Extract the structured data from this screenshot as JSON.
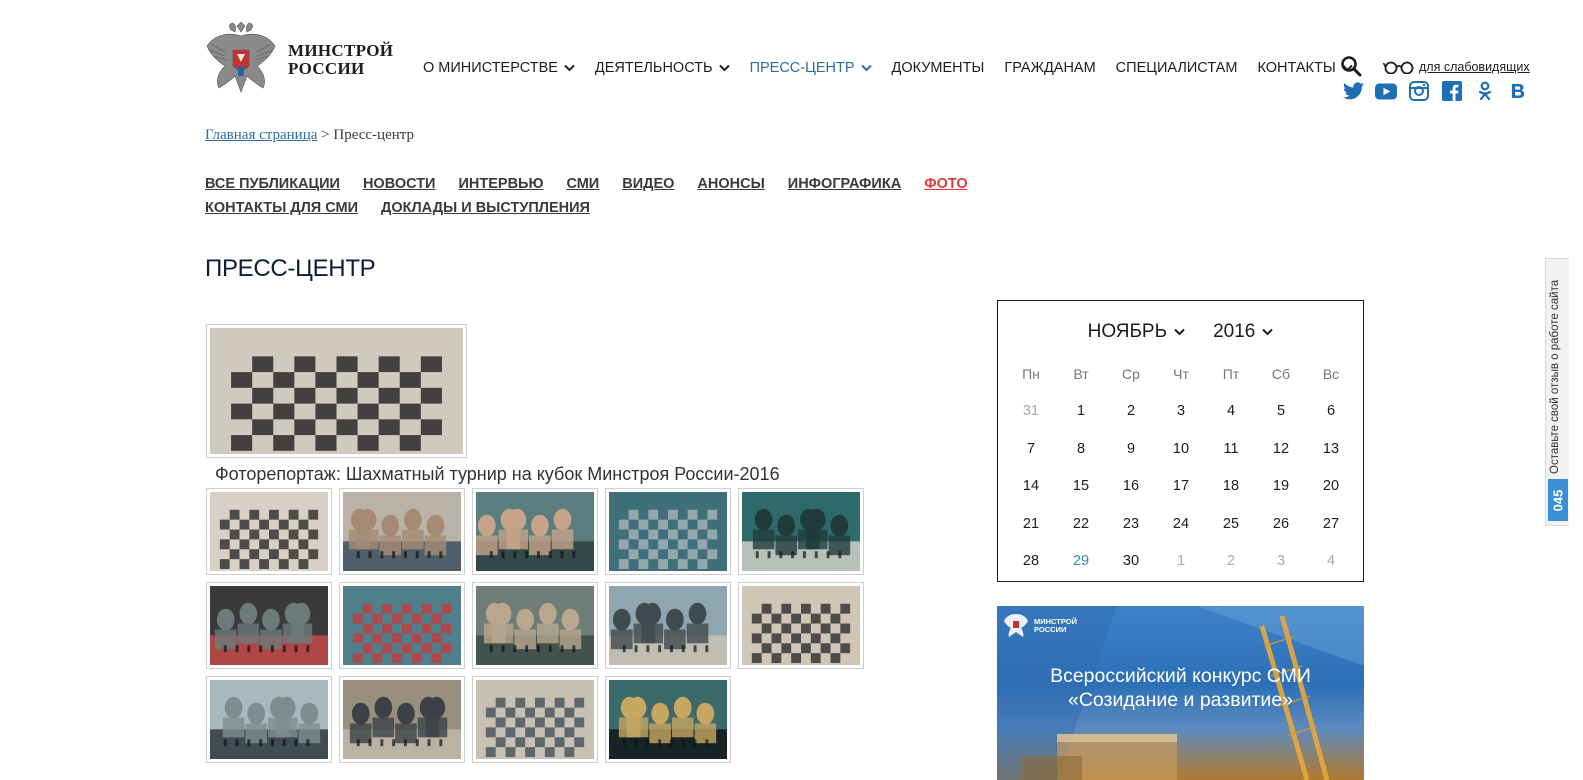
{
  "logo": {
    "line1": "МИНСТРОЙ",
    "line2": "РОССИИ"
  },
  "nav": {
    "items": [
      {
        "label": "О МИНИСТЕРСТВЕ",
        "dropdown": true,
        "active": false
      },
      {
        "label": "ДЕЯТЕЛЬНОСТЬ",
        "dropdown": true,
        "active": false
      },
      {
        "label": "ПРЕСС-ЦЕНТР",
        "dropdown": true,
        "active": true
      },
      {
        "label": "ДОКУМЕНТЫ",
        "dropdown": false,
        "active": false
      },
      {
        "label": "ГРАЖДАНАМ",
        "dropdown": false,
        "active": false
      },
      {
        "label": "СПЕЦИАЛИСТАМ",
        "dropdown": false,
        "active": false
      },
      {
        "label": "КОНТАКТЫ",
        "dropdown": true,
        "active": false
      }
    ],
    "low_vision": "для слабовидящих",
    "socials": [
      "twitter-icon",
      "youtube-icon",
      "instagram-icon",
      "facebook-icon",
      "odnoklassniki-icon",
      "vk-icon"
    ]
  },
  "breadcrumb": {
    "home": "Главная страница",
    "sep": ">",
    "current": "Пресс-центр"
  },
  "subnav": {
    "items": [
      {
        "label": "ВСЕ ПУБЛИКАЦИИ",
        "active": false
      },
      {
        "label": "НОВОСТИ",
        "active": false
      },
      {
        "label": "ИНТЕРВЬЮ",
        "active": false
      },
      {
        "label": "СМИ",
        "active": false
      },
      {
        "label": "ВИДЕО",
        "active": false
      },
      {
        "label": "АНОНСЫ",
        "active": false
      },
      {
        "label": "ИНФОГРАФИКА",
        "active": false
      },
      {
        "label": "ФОТО",
        "active": true
      },
      {
        "label": "КОНТАКТЫ ДЛЯ СМИ",
        "active": false
      },
      {
        "label": "ДОКЛАДЫ И ВЫСТУПЛЕНИЯ",
        "active": false
      }
    ]
  },
  "page_title": "ПРЕСС-ЦЕНТР",
  "gallery": {
    "caption": "Фоторепортаж: Шахматный турнир на кубок Минстроя России-2016",
    "thumb_count": 14
  },
  "calendar": {
    "month": "НОЯБРЬ",
    "year": "2016",
    "weekdays": [
      "Пн",
      "Вт",
      "Ср",
      "Чт",
      "Пт",
      "Сб",
      "Вс"
    ],
    "days": [
      {
        "d": "31",
        "s": "muted"
      },
      {
        "d": "1"
      },
      {
        "d": "2"
      },
      {
        "d": "3"
      },
      {
        "d": "4"
      },
      {
        "d": "5"
      },
      {
        "d": "6"
      },
      {
        "d": "7"
      },
      {
        "d": "8"
      },
      {
        "d": "9"
      },
      {
        "d": "10"
      },
      {
        "d": "11"
      },
      {
        "d": "12"
      },
      {
        "d": "13"
      },
      {
        "d": "14"
      },
      {
        "d": "15"
      },
      {
        "d": "16"
      },
      {
        "d": "17"
      },
      {
        "d": "18"
      },
      {
        "d": "19"
      },
      {
        "d": "20"
      },
      {
        "d": "21"
      },
      {
        "d": "22"
      },
      {
        "d": "23"
      },
      {
        "d": "24"
      },
      {
        "d": "25"
      },
      {
        "d": "26"
      },
      {
        "d": "27"
      },
      {
        "d": "28"
      },
      {
        "d": "29",
        "s": "link"
      },
      {
        "d": "30"
      },
      {
        "d": "1",
        "s": "muted"
      },
      {
        "d": "2",
        "s": "muted"
      },
      {
        "d": "3",
        "s": "muted"
      },
      {
        "d": "4",
        "s": "muted"
      }
    ]
  },
  "banner": {
    "logo_line1": "МИНСТРОЙ",
    "logo_line2": "РОССИИ",
    "line1": "Всероссийский конкурс СМИ",
    "line2": "«Созидание и развитие»"
  },
  "feedback": {
    "text": "Оставьте свой отзыв о работе сайта",
    "badge": "045"
  },
  "colors": {
    "accent": "#2f6da0",
    "active_subnav": "#e03b3b",
    "social": "#1e6fb5",
    "title": "#0f1b3a"
  }
}
